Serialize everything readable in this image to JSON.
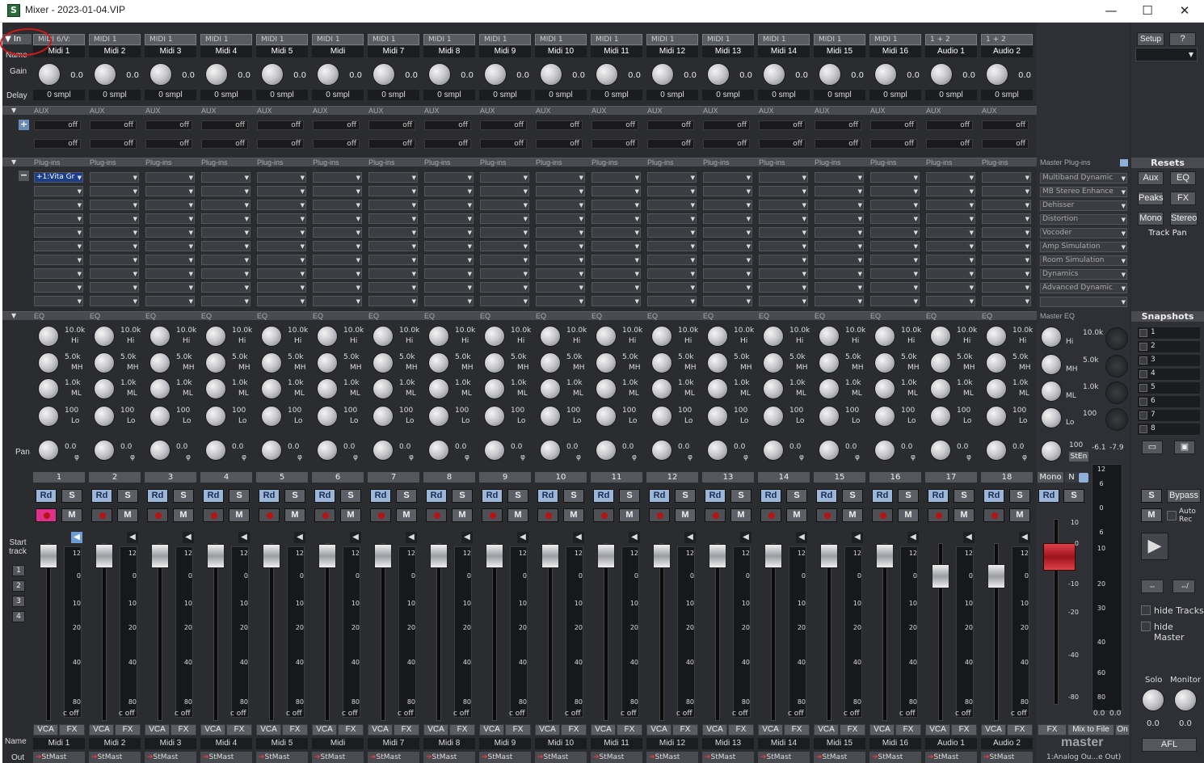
{
  "window": {
    "title": "Mixer - 2023-01-04.VIP",
    "app_icon": "S",
    "minimize": "—",
    "maximize": "☐",
    "close": "✕"
  },
  "row_labels": {
    "in": "In",
    "name": "Name",
    "gain": "Gain",
    "delay": "Delay",
    "pan": "Pan",
    "start_track": "Start track",
    "name_bottom": "Name",
    "out": "Out"
  },
  "sections": {
    "aux": "AUX",
    "plugins": "Plug-ins",
    "eq": "EQ",
    "master_plugins": "Master Plug-ins",
    "master_eq": "Master EQ",
    "resets": "Resets",
    "snapshots": "Snapshots"
  },
  "start_track_buttons": [
    "1",
    "2",
    "3",
    "4"
  ],
  "channels": [
    {
      "num": "1",
      "input": "MIDI 6/V:",
      "name": "Midi 1",
      "gain": "0.0",
      "delay": "0 smpl",
      "plugin": "+1:Vita Gr",
      "out": "StMast"
    },
    {
      "num": "2",
      "input": "MIDI 1",
      "name": "Midi 2",
      "gain": "0.0",
      "delay": "0 smpl",
      "plugin": "",
      "out": "StMast"
    },
    {
      "num": "3",
      "input": "MIDI 1",
      "name": "Midi 3",
      "gain": "0.0",
      "delay": "0 smpl",
      "plugin": "",
      "out": "StMast"
    },
    {
      "num": "4",
      "input": "MIDI 1",
      "name": "Midi 4",
      "gain": "0.0",
      "delay": "0 smpl",
      "plugin": "",
      "out": "StMast"
    },
    {
      "num": "5",
      "input": "MIDI 1",
      "name": "Midi 5",
      "gain": "0.0",
      "delay": "0 smpl",
      "plugin": "",
      "out": "StMast"
    },
    {
      "num": "6",
      "input": "MIDI 1",
      "name": "Midi",
      "gain": "0.0",
      "delay": "0 smpl",
      "plugin": "",
      "out": "StMast"
    },
    {
      "num": "7",
      "input": "MIDI 1",
      "name": "Midi 7",
      "gain": "0.0",
      "delay": "0 smpl",
      "plugin": "",
      "out": "StMast"
    },
    {
      "num": "8",
      "input": "MIDI 1",
      "name": "Midi 8",
      "gain": "0.0",
      "delay": "0 smpl",
      "plugin": "",
      "out": "StMast"
    },
    {
      "num": "9",
      "input": "MIDI 1",
      "name": "Midi 9",
      "gain": "0.0",
      "delay": "0 smpl",
      "plugin": "",
      "out": "StMast"
    },
    {
      "num": "10",
      "input": "MIDI 1",
      "name": "Midi 10",
      "gain": "0.0",
      "delay": "0 smpl",
      "plugin": "",
      "out": "StMast"
    },
    {
      "num": "11",
      "input": "MIDI 1",
      "name": "Midi 11",
      "gain": "0.0",
      "delay": "0 smpl",
      "plugin": "",
      "out": "StMast"
    },
    {
      "num": "12",
      "input": "MIDI 1",
      "name": "Midi 12",
      "gain": "0.0",
      "delay": "0 smpl",
      "plugin": "",
      "out": "StMast"
    },
    {
      "num": "13",
      "input": "MIDI 1",
      "name": "Midi 13",
      "gain": "0.0",
      "delay": "0 smpl",
      "plugin": "",
      "out": "StMast"
    },
    {
      "num": "14",
      "input": "MIDI 1",
      "name": "Midi 14",
      "gain": "0.0",
      "delay": "0 smpl",
      "plugin": "",
      "out": "StMast"
    },
    {
      "num": "15",
      "input": "MIDI 1",
      "name": "Midi 15",
      "gain": "0.0",
      "delay": "0 smpl",
      "plugin": "",
      "out": "StMast"
    },
    {
      "num": "16",
      "input": "MIDI 1",
      "name": "Midi 16",
      "gain": "0.0",
      "delay": "0 smpl",
      "plugin": "",
      "out": "StMast"
    },
    {
      "num": "17",
      "input": "1 + 2",
      "name": "Audio 1",
      "gain": "0.0",
      "delay": "0 smpl",
      "plugin": "",
      "out": "StMast"
    },
    {
      "num": "18",
      "input": "1 + 2",
      "name": "Audio 2",
      "gain": "0.0",
      "delay": "0 smpl",
      "plugin": "",
      "out": "StMast"
    }
  ],
  "aux_send": {
    "value": "off"
  },
  "eq_bands": [
    {
      "freq": "10.0k",
      "band": "Hi"
    },
    {
      "freq": "5.0k",
      "band": "MH"
    },
    {
      "freq": "1.0k",
      "band": "ML"
    },
    {
      "freq": "100",
      "band": "Lo"
    }
  ],
  "pan": {
    "value": "0.0",
    "phase": "φ"
  },
  "buttons": {
    "rd": "Rd",
    "s": "S",
    "m": "M",
    "vca": "VCA",
    "fx": "FX",
    "c_off": "c off"
  },
  "meter_scale": [
    "12",
    "0",
    "10",
    "20",
    "40",
    "80"
  ],
  "master": {
    "plugins": [
      "Multiband Dynamic",
      "MB Stereo Enhance",
      "Dehisser",
      "Distortion",
      "Vocoder",
      "Amp Simulation",
      "Room Simulation",
      "Dynamics",
      "Advanced Dynamic"
    ],
    "eq": [
      {
        "freq": "10.0k",
        "band": "Hi"
      },
      {
        "freq": "5.0k",
        "band": "MH"
      },
      {
        "freq": "1.0k",
        "band": "ML"
      },
      {
        "freq": "100",
        "band": "Lo"
      }
    ],
    "pan_value": "100",
    "pan_mode": "StEn",
    "peak_l": "-6.1",
    "peak_r": "-7.9",
    "mono": "Mono",
    "n": "N",
    "fader_scale": [
      "10",
      "0",
      "-10",
      "-20",
      "-40",
      "-80"
    ],
    "meter_scale": [
      "12",
      "6",
      "0",
      "6",
      "10",
      "20",
      "30",
      "40",
      "60",
      "80"
    ],
    "level_l": "0.0",
    "level_r": "0.0",
    "mix_to_file": "Mix to File",
    "on": "On",
    "label": "master",
    "out": "1:Analog Ou...e Out)"
  },
  "right_panel": {
    "setup": "Setup",
    "help": "?",
    "resets": [
      "Aux",
      "EQ",
      "Peaks",
      "FX",
      "Mono",
      "Stereo"
    ],
    "track_pan": "Track Pan",
    "snapshots": [
      "1",
      "2",
      "3",
      "4",
      "5",
      "6",
      "7",
      "8"
    ],
    "bypass": "Bypass",
    "auto_rec": "Auto Rec",
    "hide_tracks": "hide Tracks",
    "hide_master": "hide Master",
    "solo": "Solo",
    "monitor": "Monitor",
    "solo_value": "0.0",
    "monitor_value": "0.0",
    "afl": "AFL"
  },
  "colors": {
    "background": "#2b2c30",
    "rd_button": "#9bb6d6",
    "master_fader": "#c0242c",
    "rec_active": "#e0308a",
    "annotation": "#d01818"
  }
}
